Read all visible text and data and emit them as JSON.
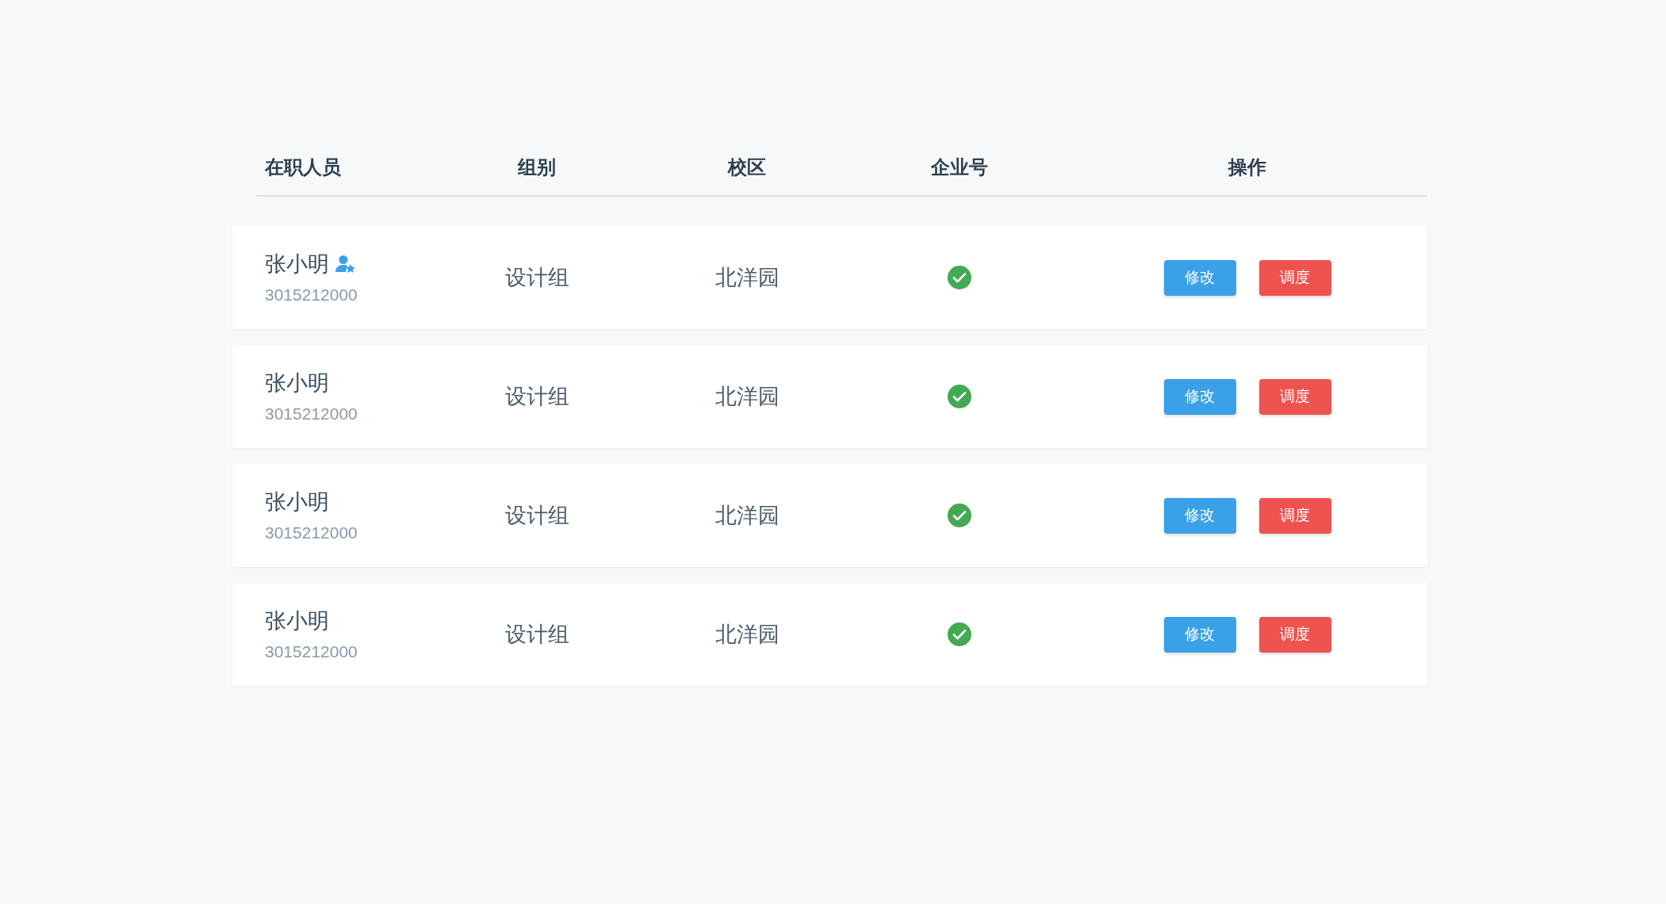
{
  "table": {
    "columns": [
      "在职人员",
      "组别",
      "校区",
      "企业号",
      "操作"
    ],
    "rows": [
      {
        "name": "张小明",
        "admin": true,
        "id": "3015212000",
        "group": "设计组",
        "campus": "北洋园",
        "verified": true,
        "actions": [
          "修改",
          "调度"
        ]
      },
      {
        "name": "张小明",
        "admin": false,
        "id": "3015212000",
        "group": "设计组",
        "campus": "北洋园",
        "verified": true,
        "actions": [
          "修改",
          "调度"
        ]
      },
      {
        "name": "张小明",
        "admin": false,
        "id": "3015212000",
        "group": "设计组",
        "campus": "北洋园",
        "verified": true,
        "actions": [
          "修改",
          "调度"
        ]
      },
      {
        "name": "张小明",
        "admin": false,
        "id": "3015212000",
        "group": "设计组",
        "campus": "北洋园",
        "verified": true,
        "actions": [
          "修改",
          "调度"
        ]
      }
    ]
  }
}
